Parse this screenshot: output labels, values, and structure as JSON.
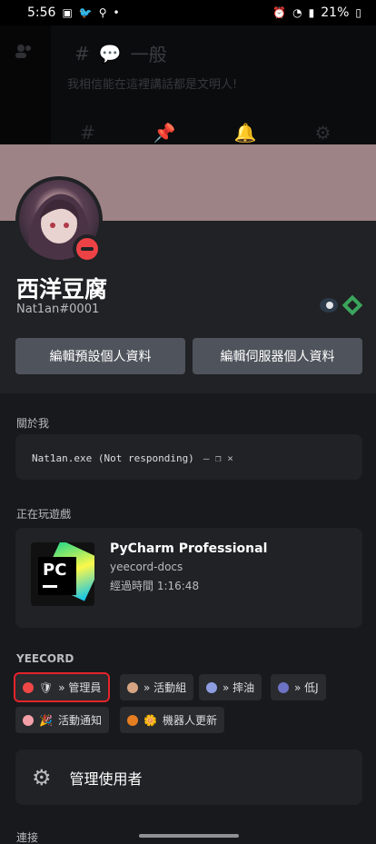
{
  "status_bar": {
    "time": "5:56",
    "battery": "21%"
  },
  "background_channel": {
    "title": "一般",
    "topic": "我相信能在這裡講話都是文明人!"
  },
  "profile": {
    "display_name": "西洋豆腐",
    "tag": "Nat1an#0001",
    "status": "dnd",
    "banner_color": "#9e8386"
  },
  "buttons": {
    "edit_default": "編輯預設個人資料",
    "edit_server": "編輯伺服器個人資料"
  },
  "about": {
    "label": "關於我",
    "text": "Nat1an.exe (Not responding)",
    "window_controls": "— ❐ ×"
  },
  "activity": {
    "label": "正在玩遊戲",
    "name": "PyCharm Professional",
    "detail": "yeecord-docs",
    "elapsed": "經過時間 1:16:48",
    "icon_text": "PC"
  },
  "server": {
    "name": "YEECORD",
    "roles": [
      {
        "name": "» 管理員",
        "color": "#f04747",
        "emoji": "🛡",
        "highlighted": true
      },
      {
        "name": "» 活動組",
        "color": "#d4a483",
        "emoji": ""
      },
      {
        "name": "» 摔油",
        "color": "#8e9de0",
        "emoji": ""
      },
      {
        "name": "» 低J",
        "color": "#6c73c4",
        "emoji": ""
      },
      {
        "name": "活動通知",
        "color": "#f4a0a8",
        "emoji": "🎉"
      },
      {
        "name": "機器人更新",
        "color": "#e67e22",
        "emoji": "🌼"
      }
    ]
  },
  "manage_users": {
    "label": "管理使用者"
  },
  "connections": {
    "label": "連接"
  }
}
